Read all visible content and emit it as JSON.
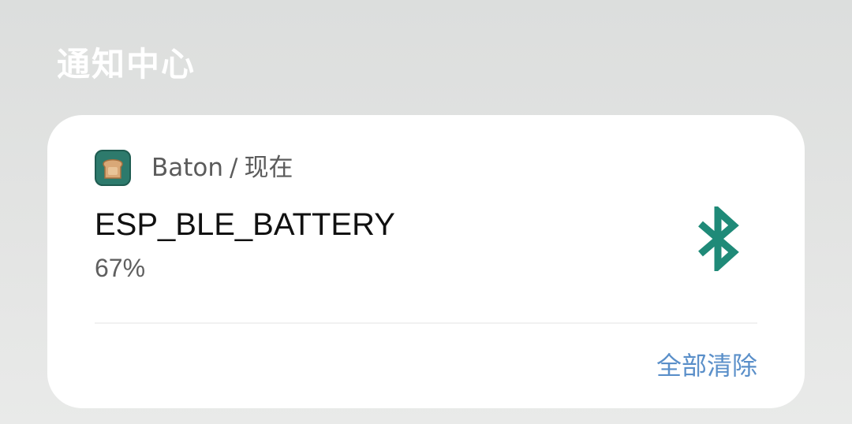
{
  "panel": {
    "title": "通知中心"
  },
  "notification": {
    "app_name": "Baton",
    "separator": "/",
    "time": "现在",
    "title": "ESP_BLE_BATTERY",
    "body": "67%",
    "app_icon": "toast-bread-icon",
    "status_icon": "bluetooth-icon"
  },
  "actions": {
    "clear_all_label": "全部清除"
  },
  "colors": {
    "accent": "#1f8a78",
    "link": "#5a8fc9",
    "app_icon_bg": "#2d7a6c",
    "toast": "#d9a877"
  }
}
